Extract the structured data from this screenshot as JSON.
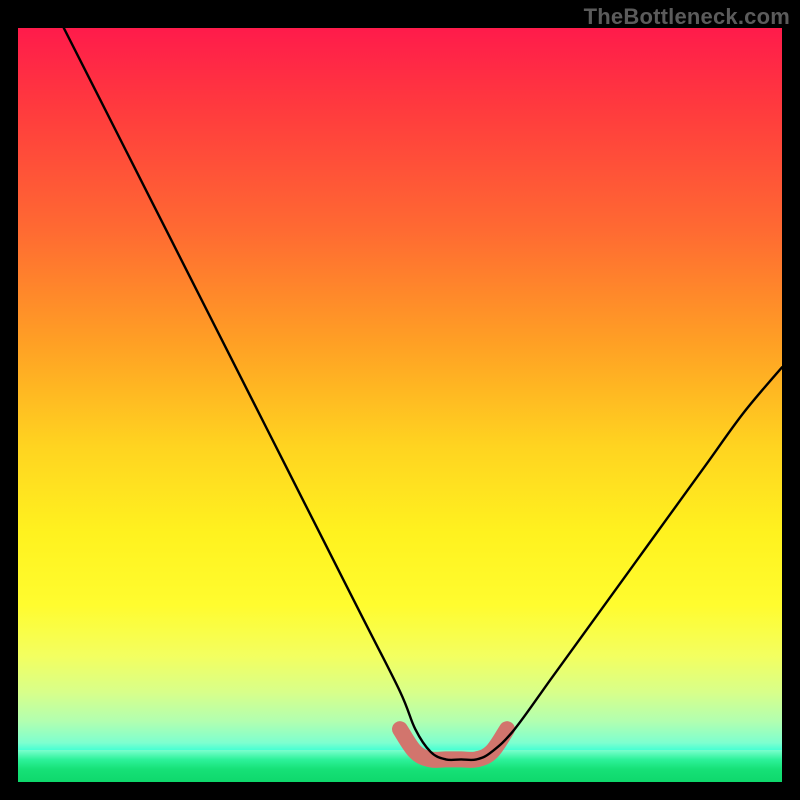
{
  "attribution": "TheBottleneck.com",
  "chart_data": {
    "type": "line",
    "title": "",
    "xlabel": "",
    "ylabel": "",
    "xlim": [
      0,
      100
    ],
    "ylim": [
      0,
      100
    ],
    "grid": false,
    "legend": false,
    "series": [
      {
        "name": "bottleneck-curve",
        "x": [
          6,
          10,
          15,
          20,
          25,
          30,
          35,
          40,
          45,
          50,
          52,
          54,
          56,
          58,
          60,
          62,
          65,
          70,
          75,
          80,
          85,
          90,
          95,
          100
        ],
        "values": [
          100,
          92,
          82,
          72,
          62,
          52,
          42,
          32,
          22,
          12,
          7,
          4,
          3,
          3,
          3,
          4,
          7,
          14,
          21,
          28,
          35,
          42,
          49,
          55
        ]
      },
      {
        "name": "optimal-zone-marker",
        "x": [
          50,
          52,
          54,
          56,
          58,
          60,
          62,
          64
        ],
        "values": [
          7,
          4,
          3,
          3,
          3,
          3,
          4,
          7
        ]
      }
    ],
    "colors": {
      "curve": "#000000",
      "marker": "#d2756d",
      "bg_top": "#ff1b4b",
      "bg_mid": "#fff21f",
      "bg_bottom": "#0ed86c"
    },
    "notes": "Axis labels and numeric ticks are not rendered. Values are estimated from image gradients (red=100 bad, green=0 good). The thin black V-curve has its minimum near x≈56–58. A thick coral marker highlights the valley."
  }
}
